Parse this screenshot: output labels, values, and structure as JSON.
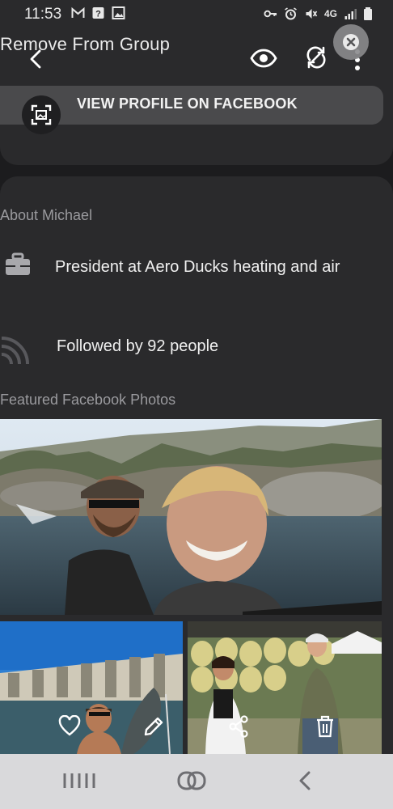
{
  "status_bar": {
    "time": "11:53",
    "network": "4G"
  },
  "header": {
    "group_title": "Remove From Group"
  },
  "profile_link": {
    "label": "VIEW PROFILE ON FACEBOOK"
  },
  "about": {
    "heading": "About Michael",
    "work": "President at Aero Ducks heating and air",
    "followers": "Followed by 92 people"
  },
  "photos": {
    "heading": "Featured Facebook Photos"
  },
  "icons": {
    "back": "chevron-left-icon",
    "view": "eye-icon",
    "sync": "sync-icon",
    "more": "more-vert-icon",
    "close": "close-icon",
    "work": "briefcase-icon",
    "followers": "rss-icon",
    "like": "heart-icon",
    "edit": "pencil-icon",
    "share": "share-icon",
    "delete": "trash-icon"
  },
  "colors": {
    "background": "#1c1c1e",
    "card": "#2a2a2c",
    "button": "#4a4a4c",
    "muted_text": "#9a9a9e",
    "nav_bar": "#d9d9db"
  }
}
